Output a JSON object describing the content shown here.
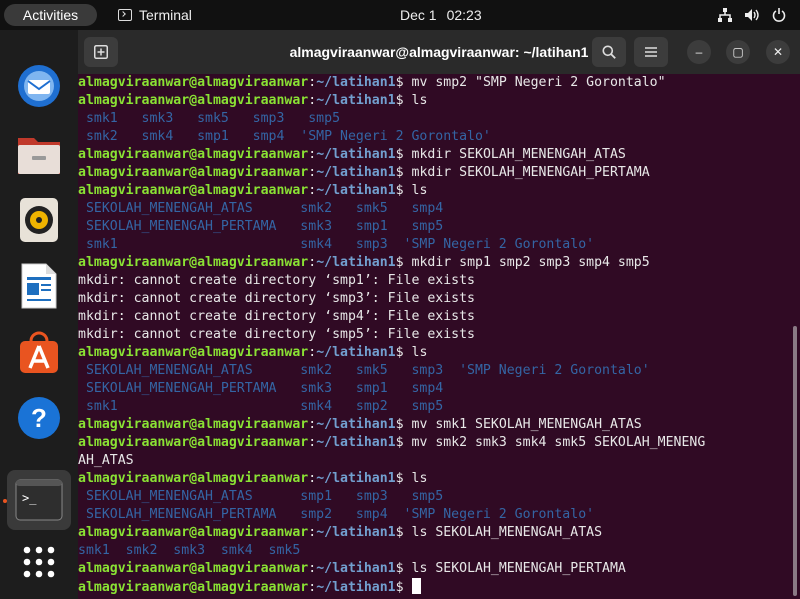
{
  "topbar": {
    "activities": "Activities",
    "app_name": "Terminal",
    "date": "Dec 1",
    "time": "02:23"
  },
  "dock": {
    "items": [
      {
        "name": "thunderbird-icon"
      },
      {
        "name": "files-icon"
      },
      {
        "name": "rhythmbox-icon"
      },
      {
        "name": "writer-icon"
      },
      {
        "name": "app-center-icon"
      },
      {
        "name": "help-icon"
      },
      {
        "name": "terminal-icon"
      },
      {
        "name": "show-apps-icon"
      }
    ]
  },
  "window": {
    "title": "almagviraanwar@almagviraanwar: ~/latihan1",
    "new_tab": "+",
    "minimize": "–",
    "maximize": "▢",
    "close": "✕"
  },
  "prompt": {
    "user": "almagviraanwar@almagviraanwar",
    "sep": ":",
    "path": "~/latihan1",
    "sign": "$ "
  },
  "lines": [
    {
      "t": "p",
      "cmd": "mv smp2 \"SMP Negeri 2 Gorontalo\""
    },
    {
      "t": "p",
      "cmd": "ls"
    },
    {
      "t": "d",
      "text": " smk1   smk3   smk5   smp3   smp5"
    },
    {
      "t": "d",
      "text": " smk2   smk4   smp1   smp4  'SMP Negeri 2 Gorontalo'"
    },
    {
      "t": "p",
      "cmd": "mkdir SEKOLAH_MENENGAH_ATAS"
    },
    {
      "t": "p",
      "cmd": "mkdir SEKOLAH_MENENGAH_PERTAMA"
    },
    {
      "t": "p",
      "cmd": "ls"
    },
    {
      "t": "d",
      "text": " SEKOLAH_MENENGAH_ATAS      smk2   smk5   smp4"
    },
    {
      "t": "d",
      "text": " SEKOLAH_MENENGAH_PERTAMA   smk3   smp1   smp5"
    },
    {
      "t": "d",
      "text": " smk1                       smk4   smp3  'SMP Negeri 2 Gorontalo'"
    },
    {
      "t": "p",
      "cmd": "mkdir smp1 smp2 smp3 smp4 smp5"
    },
    {
      "t": "w",
      "text": "mkdir: cannot create directory ‘smp1’: File exists"
    },
    {
      "t": "w",
      "text": "mkdir: cannot create directory ‘smp3’: File exists"
    },
    {
      "t": "w",
      "text": "mkdir: cannot create directory ‘smp4’: File exists"
    },
    {
      "t": "w",
      "text": "mkdir: cannot create directory ‘smp5’: File exists"
    },
    {
      "t": "p",
      "cmd": "ls"
    },
    {
      "t": "d",
      "text": " SEKOLAH_MENENGAH_ATAS      smk2   smk5   smp3  'SMP Negeri 2 Gorontalo'"
    },
    {
      "t": "d",
      "text": " SEKOLAH_MENENGAH_PERTAMA   smk3   smp1   smp4"
    },
    {
      "t": "d",
      "text": " smk1                       smk4   smp2   smp5"
    },
    {
      "t": "p",
      "cmd": "mv smk1 SEKOLAH_MENENGAH_ATAS"
    },
    {
      "t": "p",
      "cmd": "mv smk2 smk3 smk4 smk5 SEKOLAH_MENENG"
    },
    {
      "t": "w",
      "text": "AH_ATAS"
    },
    {
      "t": "p",
      "cmd": "ls"
    },
    {
      "t": "d",
      "text": " SEKOLAH_MENENGAH_ATAS      smp1   smp3   smp5"
    },
    {
      "t": "d",
      "text": " SEKOLAH_MENENGAH_PERTAMA   smp2   smp4  'SMP Negeri 2 Gorontalo'"
    },
    {
      "t": "p",
      "cmd": "ls SEKOLAH_MENENGAH_ATAS"
    },
    {
      "t": "d",
      "text": "smk1  smk2  smk3  smk4  smk5"
    },
    {
      "t": "p",
      "cmd": "ls SEKOLAH_MENENGAH_PERTAMA"
    },
    {
      "t": "p",
      "cmd": "",
      "cursor": true
    }
  ],
  "colors": {
    "prompt_user": "#8ae234",
    "prompt_path": "#729fcf",
    "directory": "#3465a4",
    "background": "#300a24"
  }
}
